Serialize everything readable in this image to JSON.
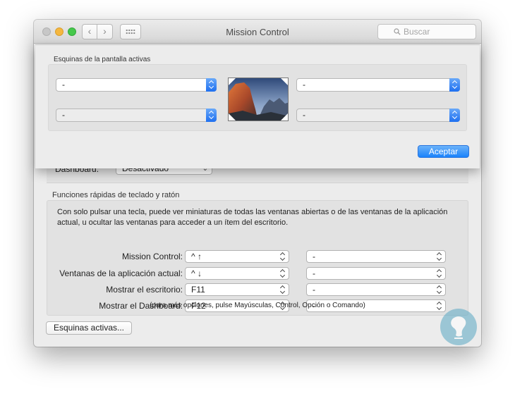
{
  "window": {
    "title": "Mission Control",
    "nav_back": "‹",
    "nav_forward": "›",
    "search_placeholder": "Buscar"
  },
  "background": {
    "dashboard_label": "Dashboard:",
    "dashboard_value": "Desactivado",
    "shortcuts_title": "Funciones rápidas de teclado y ratón",
    "description": "Con solo pulsar una tecla, puede ver miniaturas de todas las ventanas abiertas o de las ventanas de la aplicación actual, u ocultar las ventanas para acceder a un ítem del escritorio.",
    "rows": [
      {
        "label": "Mission Control:",
        "key": "^ ↑",
        "mouse": "-"
      },
      {
        "label": "Ventanas de la aplicación actual:",
        "key": "^ ↓",
        "mouse": "-"
      },
      {
        "label": "Mostrar el escritorio:",
        "key": "F11",
        "mouse": "-"
      },
      {
        "label": "Mostrar el Dashboard:",
        "key": "F12",
        "mouse": "-"
      }
    ],
    "hint": "(para más opciones, pulse Mayúsculas, Control, Opción o Comando)",
    "hot_corners_button": "Esquinas activas..."
  },
  "sheet": {
    "title": "Esquinas de la pantalla activas",
    "top_left": "-",
    "top_right": "-",
    "bottom_left": "-",
    "bottom_right": "-",
    "accept_button": "Aceptar"
  },
  "colors": {
    "accent": "#1a82fb",
    "window_bg": "#ececec"
  }
}
